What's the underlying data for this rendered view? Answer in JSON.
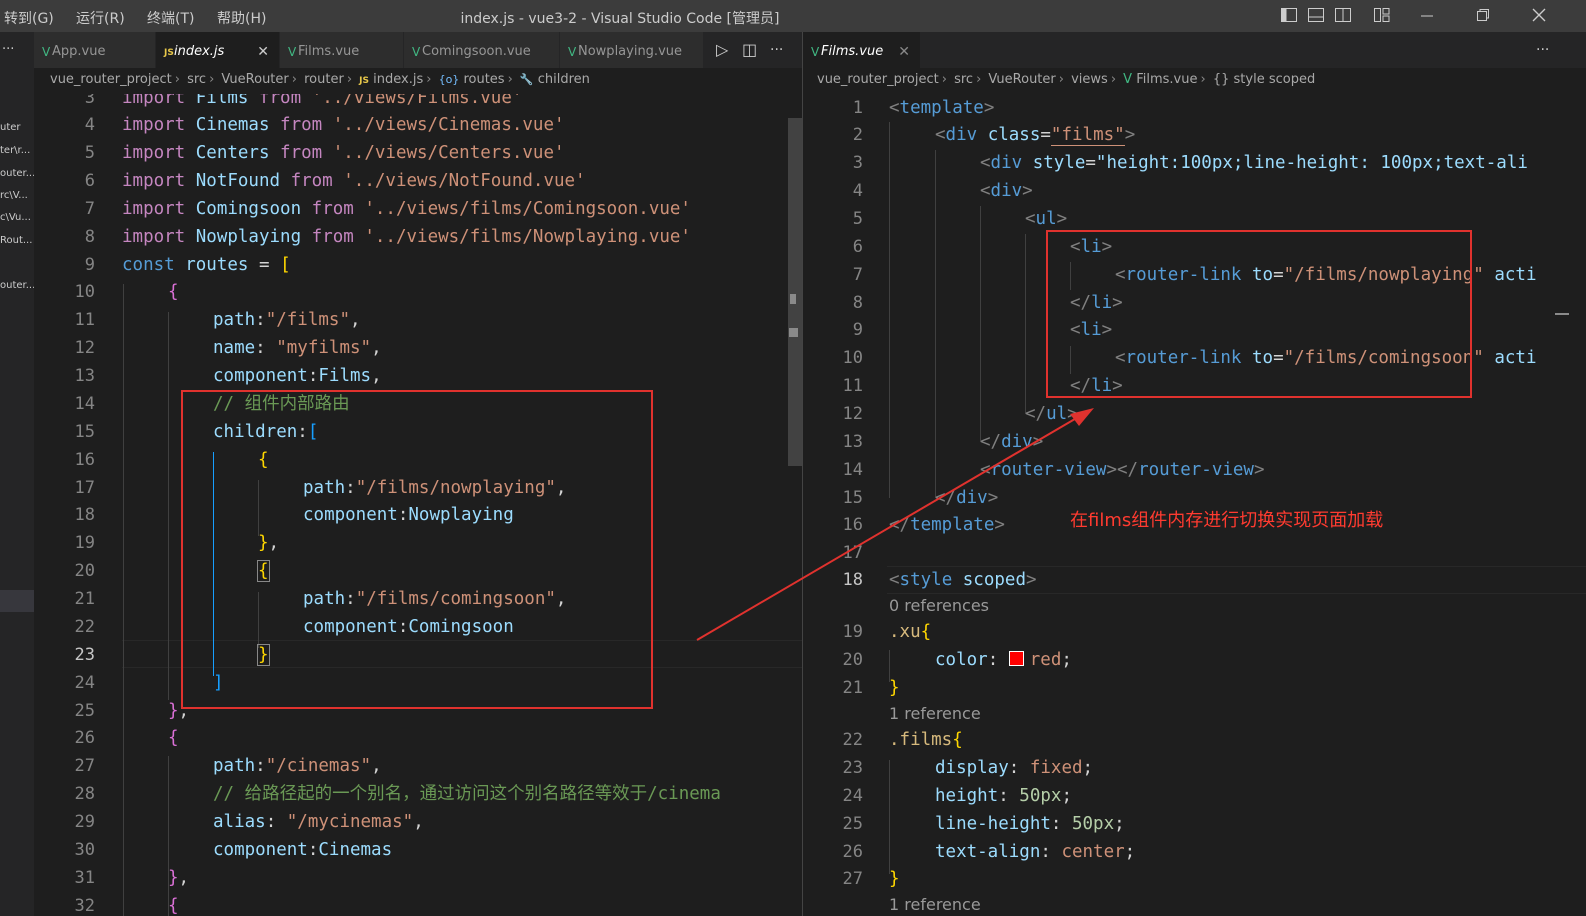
{
  "titlebar": {
    "menus": [
      "转到(G)",
      "运行(R)",
      "终端(T)",
      "帮助(H)"
    ],
    "title": "index.js - vue3-2 - Visual Studio Code [管理员]",
    "controls": [
      "toggle-sidebar-icon",
      "toggle-panel-icon",
      "toggle-secondary-sidebar-icon",
      "customize-layout-icon",
      "minimize-icon",
      "restore-icon",
      "close-icon"
    ]
  },
  "sidebar": {
    "more": "···",
    "items": [
      "uter",
      "ter\\r...",
      "outer...",
      "rc\\V...",
      "c\\Vu...",
      "Rout...",
      "outer..."
    ]
  },
  "left_editor": {
    "tabs": [
      {
        "label": "App.vue",
        "icon": "V",
        "active": false
      },
      {
        "label": "index.js",
        "icon": "JS",
        "active": true,
        "close": "✕"
      },
      {
        "label": "Films.vue",
        "icon": "V",
        "active": false
      },
      {
        "label": "Comingsoon.vue",
        "icon": "V",
        "active": false
      },
      {
        "label": "Nowplaying.vue",
        "icon": "V",
        "active": false
      }
    ],
    "actions": {
      "run": "▷",
      "split": "◫",
      "more": "···"
    },
    "breadcrumb": {
      "parts": [
        "vue_router_project",
        "src",
        "VueRouter",
        "router",
        "index.js",
        "routes",
        "children"
      ],
      "icons": {
        "file": "JS",
        "variable": "{o}",
        "property": "🔧"
      }
    },
    "line_numbers": [
      "3",
      "4",
      "5",
      "6",
      "7",
      "8",
      "9",
      "10",
      "11",
      "12",
      "13",
      "14",
      "15",
      "16",
      "17",
      "18",
      "19",
      "20",
      "21",
      "22",
      "23",
      "24",
      "25",
      "26",
      "27",
      "28",
      "29",
      "30",
      "31",
      "32"
    ],
    "current_line": "23",
    "code": {
      "l3": [
        "import",
        " Films ",
        "from",
        " '../views/Films.vue'"
      ],
      "l4": [
        "import",
        " Cinemas ",
        "from",
        " '../views/Cinemas.vue'"
      ],
      "l5": [
        "import",
        " Centers ",
        "from",
        " '../views/Centers.vue'"
      ],
      "l6": [
        "import",
        " NotFound ",
        "from",
        " '../views/NotFound.vue'"
      ],
      "l7": [
        "import",
        " Comingsoon ",
        "from",
        " '../views/films/Comingsoon.vue'"
      ],
      "l8": [
        "import",
        " Nowplaying ",
        "from",
        " '../views/films/Nowplaying.vue'"
      ],
      "l9": [
        "const",
        " routes ",
        "=",
        " ["
      ],
      "l10": [
        "{"
      ],
      "l11": [
        "path",
        ":",
        "\"/films\"",
        ","
      ],
      "l12": [
        "name",
        ": ",
        "\"myfilms\"",
        ","
      ],
      "l13": [
        "component",
        ":",
        "Films",
        ","
      ],
      "l14": [
        "// 组件内部路由"
      ],
      "l15": [
        "children",
        ":",
        "["
      ],
      "l16": [
        "{"
      ],
      "l17": [
        "path",
        ":",
        "\"/films/nowplaying\"",
        ","
      ],
      "l18": [
        "component",
        ":",
        "Nowplaying"
      ],
      "l19": [
        "}",
        ","
      ],
      "l20": [
        "{"
      ],
      "l21": [
        "path",
        ":",
        "\"/films/comingsoon\"",
        ","
      ],
      "l22": [
        "component",
        ":",
        "Comingsoon"
      ],
      "l23": [
        "}"
      ],
      "l24": [
        "]"
      ],
      "l25": [
        "}",
        ","
      ],
      "l26": [
        "{"
      ],
      "l27": [
        "path",
        ":",
        "\"/cinemas\"",
        ","
      ],
      "l28": [
        "// 给路径起的一个别名，通过访问这个别名路径等效于/cinema"
      ],
      "l29": [
        "alias",
        ": ",
        "\"/mycinemas\"",
        ","
      ],
      "l30": [
        "component",
        ":",
        "Cinemas"
      ],
      "l31": [
        "}",
        ","
      ],
      "l32": [
        "{"
      ]
    }
  },
  "right_editor": {
    "tab": {
      "label": "Films.vue",
      "icon": "V",
      "close": "✕"
    },
    "more": "···",
    "breadcrumb": {
      "parts": [
        "vue_router_project",
        "src",
        "VueRouter",
        "views",
        "Films.vue",
        "style scoped"
      ],
      "icons": {
        "file": "V",
        "block": "{}"
      }
    },
    "current_line": "18",
    "code": {
      "l1": [
        "<",
        "template",
        ">"
      ],
      "l2": [
        "<",
        "div",
        " class",
        "=",
        "\"films\"",
        ">"
      ],
      "l3": [
        "<",
        "div",
        " style",
        "=",
        "\"height:100px;line-height: 100px;text-ali"
      ],
      "l4": [
        "<",
        "div",
        ">"
      ],
      "l5": [
        "<",
        "ul",
        ">"
      ],
      "l6": [
        "<",
        "li",
        ">"
      ],
      "l7": [
        "<",
        "router-link",
        " to",
        "=",
        "\"/films/nowplaying\"",
        " acti"
      ],
      "l8": [
        "</",
        "li",
        ">"
      ],
      "l9": [
        "<",
        "li",
        ">"
      ],
      "l10": [
        "<",
        "router-link",
        " to",
        "=",
        "\"/films/comingsoon\"",
        " acti"
      ],
      "l11": [
        "</",
        "li",
        ">"
      ],
      "l12": [
        "</",
        "ul",
        ">"
      ],
      "l13": [
        "</",
        "div",
        ">"
      ],
      "l14": [
        "<",
        "router-view",
        "></",
        "router-view",
        ">"
      ],
      "l15": [
        "</",
        "div",
        ">"
      ],
      "l16": [
        "</",
        "template",
        ">"
      ],
      "l17": [
        ""
      ],
      "l18": [
        "<",
        "style",
        " scoped",
        ">"
      ],
      "lens18": "0 references",
      "l19": [
        ".xu",
        "{"
      ],
      "l20": [
        "color",
        ": ",
        "red",
        ";"
      ],
      "l21": [
        "}"
      ],
      "lens21": "1 reference",
      "l22": [
        ".films",
        "{"
      ],
      "l23": [
        "display",
        ": ",
        "fixed",
        ";"
      ],
      "l24": [
        "height",
        ": ",
        "50px",
        ";"
      ],
      "l25": [
        "line-height",
        ": ",
        "50px",
        ";"
      ],
      "l26": [
        "text-align",
        ": ",
        "center",
        ";"
      ],
      "l27": [
        "}"
      ],
      "lens27": "1 reference"
    },
    "line_numbers": [
      "1",
      "2",
      "3",
      "4",
      "5",
      "6",
      "7",
      "8",
      "9",
      "10",
      "11",
      "12",
      "13",
      "14",
      "15",
      "16",
      "17",
      "18",
      "19",
      "20",
      "21",
      "22",
      "23",
      "24",
      "25",
      "26",
      "27"
    ]
  },
  "annotation": {
    "text": "在films组件内存进行切换实现页面加载",
    "color": "#e0322e"
  }
}
